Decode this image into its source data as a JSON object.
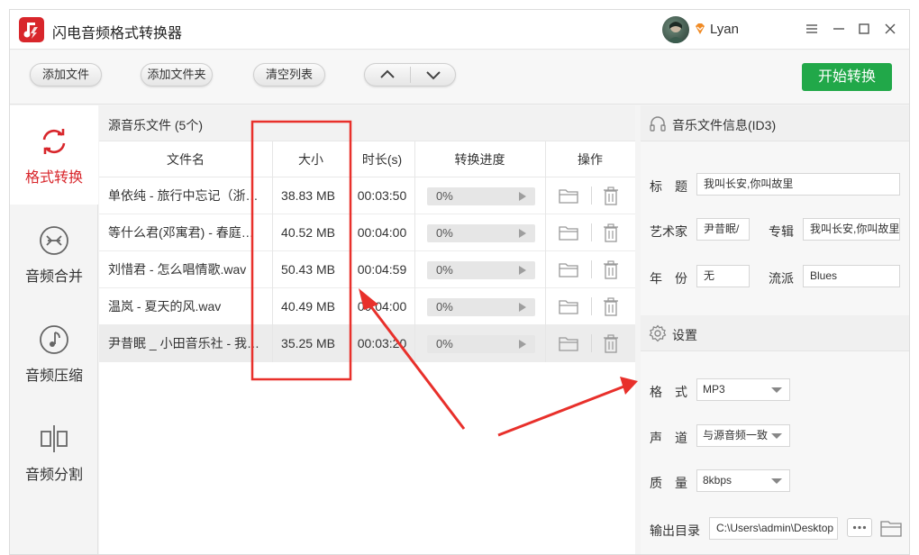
{
  "app": {
    "title": "闪电音频格式转换器",
    "user": "Lyan",
    "accent_color": "#d8262b",
    "start_color": "#21a849"
  },
  "toolbar": {
    "add_file": "添加文件",
    "add_folder": "添加文件夹",
    "clear_list": "清空列表",
    "start": "开始转换"
  },
  "sidebar": {
    "items": [
      {
        "label": "格式转换",
        "icon": "refresh-icon",
        "active": true
      },
      {
        "label": "音频合并",
        "icon": "merge-icon",
        "active": false
      },
      {
        "label": "音频压缩",
        "icon": "music-note-icon",
        "active": false
      },
      {
        "label": "音频分割",
        "icon": "split-icon",
        "active": false
      }
    ]
  },
  "filelist": {
    "title": "源音乐文件 (5个)",
    "columns": {
      "name": "文件名",
      "size": "大小",
      "duration": "时长(s)",
      "progress": "转换进度",
      "actions": "操作"
    },
    "rows": [
      {
        "name": "单依纯 - 旅行中忘记（浙江卫视…",
        "size": "38.83 MB",
        "duration": "00:03:50",
        "progress": "0%"
      },
      {
        "name": "等什么君(邓寓君) - 春庭雪.wav",
        "size": "40.52 MB",
        "duration": "00:04:00",
        "progress": "0%"
      },
      {
        "name": "刘惜君 - 怎么唱情歌.wav",
        "size": "50.43 MB",
        "duration": "00:04:59",
        "progress": "0%"
      },
      {
        "name": "温岚 - 夏天的风.wav",
        "size": "40.49 MB",
        "duration": "00:04:00",
        "progress": "0%"
      },
      {
        "name": "尹昔眠 _ 小田音乐社 - 我叫长安.wav",
        "size": "35.25 MB",
        "duration": "00:03:20",
        "progress": "0%"
      }
    ]
  },
  "id3": {
    "header": "音乐文件信息(ID3)",
    "title_label": "标　题",
    "title_value": "我叫长安,你叫故里",
    "artist_label": "艺术家",
    "artist_value": "尹昔眠/",
    "album_label": "专辑",
    "album_value": "我叫长安,你叫故里",
    "year_label": "年　份",
    "year_value": "无",
    "genre_label": "流派",
    "genre_value": "Blues"
  },
  "settings": {
    "header": "设置",
    "format_label": "格　式",
    "format_value": "MP3",
    "channel_label": "声　道",
    "channel_value": "与源音频一致",
    "quality_label": "质　量",
    "quality_value": "8kbps",
    "output_label": "输出目录",
    "output_value": "C:\\Users\\admin\\Desktop"
  }
}
